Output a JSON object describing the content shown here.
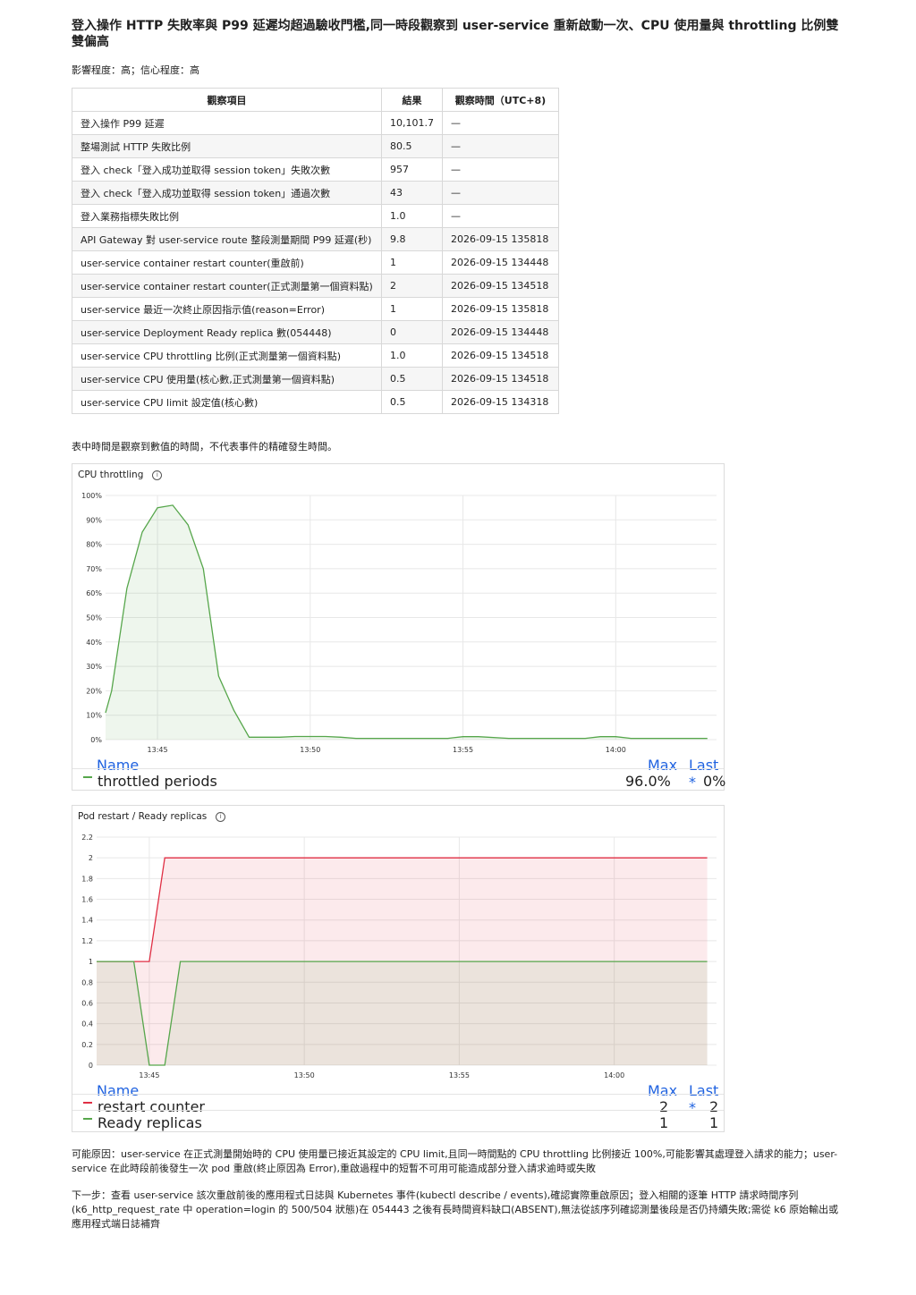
{
  "title": "登入操作 HTTP 失敗率與 P99 延遲均超過驗收門檻,同一時段觀察到 user-service 重新啟動一次、CPU 使用量與 throttling 比例雙雙偏高",
  "impact": "影響程度：高；信心程度：高",
  "table": {
    "headers": [
      "觀察項目",
      "結果",
      "觀察時間（UTC+8)"
    ],
    "rows": [
      [
        "登入操作 P99 延遲",
        "10,101.7",
        "—"
      ],
      [
        "整場測試 HTTP 失敗比例",
        "80.5",
        "—"
      ],
      [
        "登入 check「登入成功並取得 session token」失敗次數",
        "957",
        "—"
      ],
      [
        "登入 check「登入成功並取得 session token」通過次數",
        "43",
        "—"
      ],
      [
        "登入業務指標失敗比例",
        "1.0",
        "—"
      ],
      [
        "API Gateway 對 user-service route 整段測量期間 P99 延遲(秒)",
        "9.8",
        "2026-09-15 135818"
      ],
      [
        "user-service container restart counter(重啟前)",
        "1",
        "2026-09-15 134448"
      ],
      [
        "user-service container restart counter(正式測量第一個資料點)",
        "2",
        "2026-09-15 134518"
      ],
      [
        "user-service 最近一次終止原因指示值(reason=Error)",
        "1",
        "2026-09-15 135818"
      ],
      [
        "user-service Deployment Ready replica 數(054448)",
        "0",
        "2026-09-15 134448"
      ],
      [
        "user-service CPU throttling 比例(正式測量第一個資料點)",
        "1.0",
        "2026-09-15 134518"
      ],
      [
        "user-service CPU 使用量(核心數,正式測量第一個資料點)",
        "0.5",
        "2026-09-15 134518"
      ],
      [
        "user-service CPU limit 設定值(核心數)",
        "0.5",
        "2026-09-15 134318"
      ]
    ]
  },
  "note": "表中時間是觀察到數值的時間，不代表事件的精確發生時間。",
  "chart_data": [
    {
      "type": "area",
      "title": "CPU throttling",
      "x_ticks": [
        "13:45",
        "13:50",
        "13:55",
        "14:00"
      ],
      "y_ticks": [
        "0%",
        "10%",
        "20%",
        "30%",
        "40%",
        "50%",
        "60%",
        "70%",
        "80%",
        "90%",
        "100%"
      ],
      "ylim": [
        0,
        100
      ],
      "xlim": [
        0,
        20
      ],
      "grid": true,
      "legend_header": {
        "name": "Name",
        "max": "Max",
        "last": "Last *"
      },
      "series": [
        {
          "name": "throttled periods",
          "color": "#56a64b",
          "max": "96.0%",
          "last": "0%",
          "x": [
            0,
            0.2,
            0.7,
            1.2,
            1.7,
            2.2,
            2.7,
            3.2,
            3.7,
            4.2,
            4.7,
            5.7,
            6.2,
            7.2,
            7.7,
            8.2,
            11.2,
            11.7,
            12.2,
            13.2,
            13.7,
            15.7,
            16.2,
            16.7,
            17.2,
            19.7
          ],
          "y": [
            11,
            20,
            62,
            85,
            95,
            96,
            88,
            70,
            26,
            12,
            1,
            1,
            1.3,
            1.3,
            1,
            0.5,
            0.5,
            1.2,
            1.2,
            0.5,
            0.5,
            0.5,
            1.2,
            1.2,
            0.5,
            0.5
          ]
        }
      ]
    },
    {
      "type": "area",
      "title": "Pod restart / Ready replicas",
      "x_ticks": [
        "13:45",
        "13:50",
        "13:55",
        "14:00"
      ],
      "y_ticks": [
        "0",
        "0.2",
        "0.4",
        "0.6",
        "0.8",
        "1",
        "1.2",
        "1.4",
        "1.6",
        "1.8",
        "2",
        "2.2"
      ],
      "ylim": [
        0,
        2.2
      ],
      "xlim": [
        0,
        20
      ],
      "grid": true,
      "legend_header": {
        "name": "Name",
        "max": "Max",
        "last": "Last *"
      },
      "series": [
        {
          "name": "restart counter",
          "color": "#e02f44",
          "max": "2",
          "last": "2",
          "x": [
            0,
            1.2,
            1.7,
            2.2,
            19.7
          ],
          "y": [
            1,
            1,
            1,
            2,
            2
          ]
        },
        {
          "name": "Ready replicas",
          "color": "#56a64b",
          "max": "1",
          "last": "1",
          "x": [
            0,
            1.2,
            1.7,
            2.2,
            2.7,
            19.7
          ],
          "y": [
            1,
            1,
            0,
            0,
            1,
            1
          ]
        }
      ]
    }
  ],
  "cause": "可能原因：user-service 在正式測量開始時的 CPU 使用量已接近其設定的 CPU limit,且同一時間點的 CPU throttling 比例接近 100%,可能影響其處理登入請求的能力；user-service 在此時段前後發生一次 pod 重啟(終止原因為 Error),重啟過程中的短暫不可用可能造成部分登入請求逾時或失敗",
  "next_step": "下一步：查看 user-service 該次重啟前後的應用程式日誌與 Kubernetes 事件(kubectl describe / events),確認實際重啟原因；登入相關的逐筆 HTTP 請求時間序列(k6_http_request_rate 中 operation=login 的 500/504 狀態)在 054443 之後有長時間資料缺口(ABSENT),無法從該序列確認測量後段是否仍持續失敗;需從 k6 原始輸出或應用程式端日誌補齊"
}
